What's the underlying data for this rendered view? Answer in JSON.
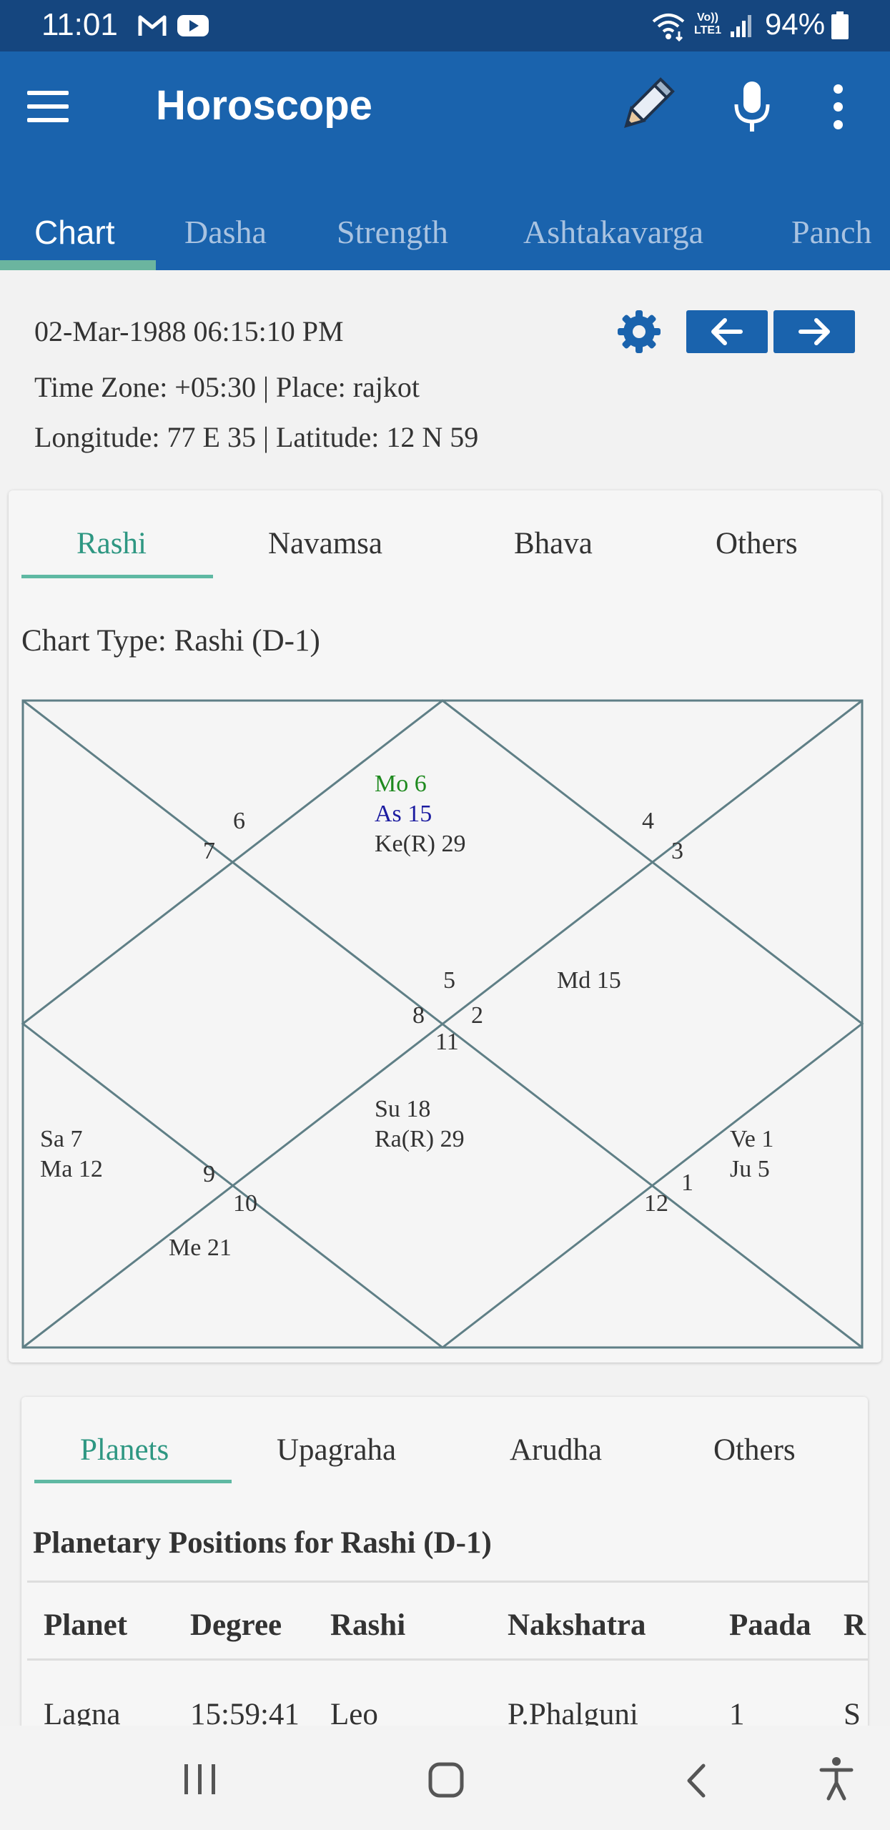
{
  "status_bar": {
    "time": "11:01",
    "notification_icons": [
      "gmail-icon",
      "youtube-icon"
    ],
    "system_icons": [
      "wifi-icon",
      "volte-icon",
      "signal-icon"
    ],
    "volte_label": "Vo)) LTE1",
    "battery": "94%"
  },
  "app_bar": {
    "title": "Horoscope",
    "tabs": [
      {
        "label": "Chart",
        "active": true
      },
      {
        "label": "Dasha",
        "active": false
      },
      {
        "label": "Strength",
        "active": false
      },
      {
        "label": "Ashtakavarga",
        "active": false
      },
      {
        "label": "Panch",
        "active": false
      }
    ]
  },
  "birth_info": {
    "datetime": "02-Mar-1988 06:15:10 PM",
    "timezone_place": "Time Zone: +05:30 | Place: rajkot",
    "lon_lat": "Longitude: 77 E 35 | Latitude: 12 N 59"
  },
  "chart_card": {
    "tabs": [
      {
        "label": "Rashi",
        "active": true
      },
      {
        "label": "Navamsa",
        "active": false
      },
      {
        "label": "Bhava",
        "active": false
      },
      {
        "label": "Others",
        "active": false
      }
    ],
    "chart_type": "Chart Type: Rashi (D-1)",
    "house_numbers": [
      "6",
      "7",
      "4",
      "3",
      "5",
      "8",
      "2",
      "11",
      "9",
      "10",
      "1",
      "12"
    ],
    "house_planets": {
      "top": [
        {
          "text": "Mo 6",
          "color": "#1f8a1f"
        },
        {
          "text": "As 15",
          "color": "#1c1ca0"
        },
        {
          "text": "Ke(R) 29",
          "color": "#333333"
        }
      ],
      "right_top": [
        {
          "text": "Md 15",
          "color": "#333333"
        }
      ],
      "bottom_center": [
        {
          "text": "Su 18",
          "color": "#333333"
        },
        {
          "text": "Ra(R) 29",
          "color": "#333333"
        }
      ],
      "left_middle": [
        {
          "text": "Sa 7",
          "color": "#333333"
        },
        {
          "text": "Ma 12",
          "color": "#333333"
        }
      ],
      "right_middle": [
        {
          "text": "Ve 1",
          "color": "#333333"
        },
        {
          "text": "Ju 5",
          "color": "#333333"
        }
      ],
      "bottom_left": [
        {
          "text": "Me 21",
          "color": "#333333"
        }
      ]
    },
    "line_color": "#5f7f86"
  },
  "planets_card": {
    "tabs": [
      {
        "label": "Planets",
        "active": true
      },
      {
        "label": "Upagraha",
        "active": false
      },
      {
        "label": "Arudha",
        "active": false
      },
      {
        "label": "Others",
        "active": false
      }
    ],
    "title": "Planetary Positions for Rashi (D-1)",
    "columns": [
      "Planet",
      "Degree",
      "Rashi",
      "Nakshatra",
      "Paada",
      "R"
    ],
    "rows": [
      [
        "Lagna",
        "15:59:41",
        "Leo",
        "P.Phalguni",
        "1",
        "S"
      ]
    ]
  },
  "colors": {
    "status_bar": "#15467f",
    "app_bar": "#1a63ad",
    "tab_indicator": "#6bb59f",
    "sub_tab_active": "#2e9782"
  }
}
